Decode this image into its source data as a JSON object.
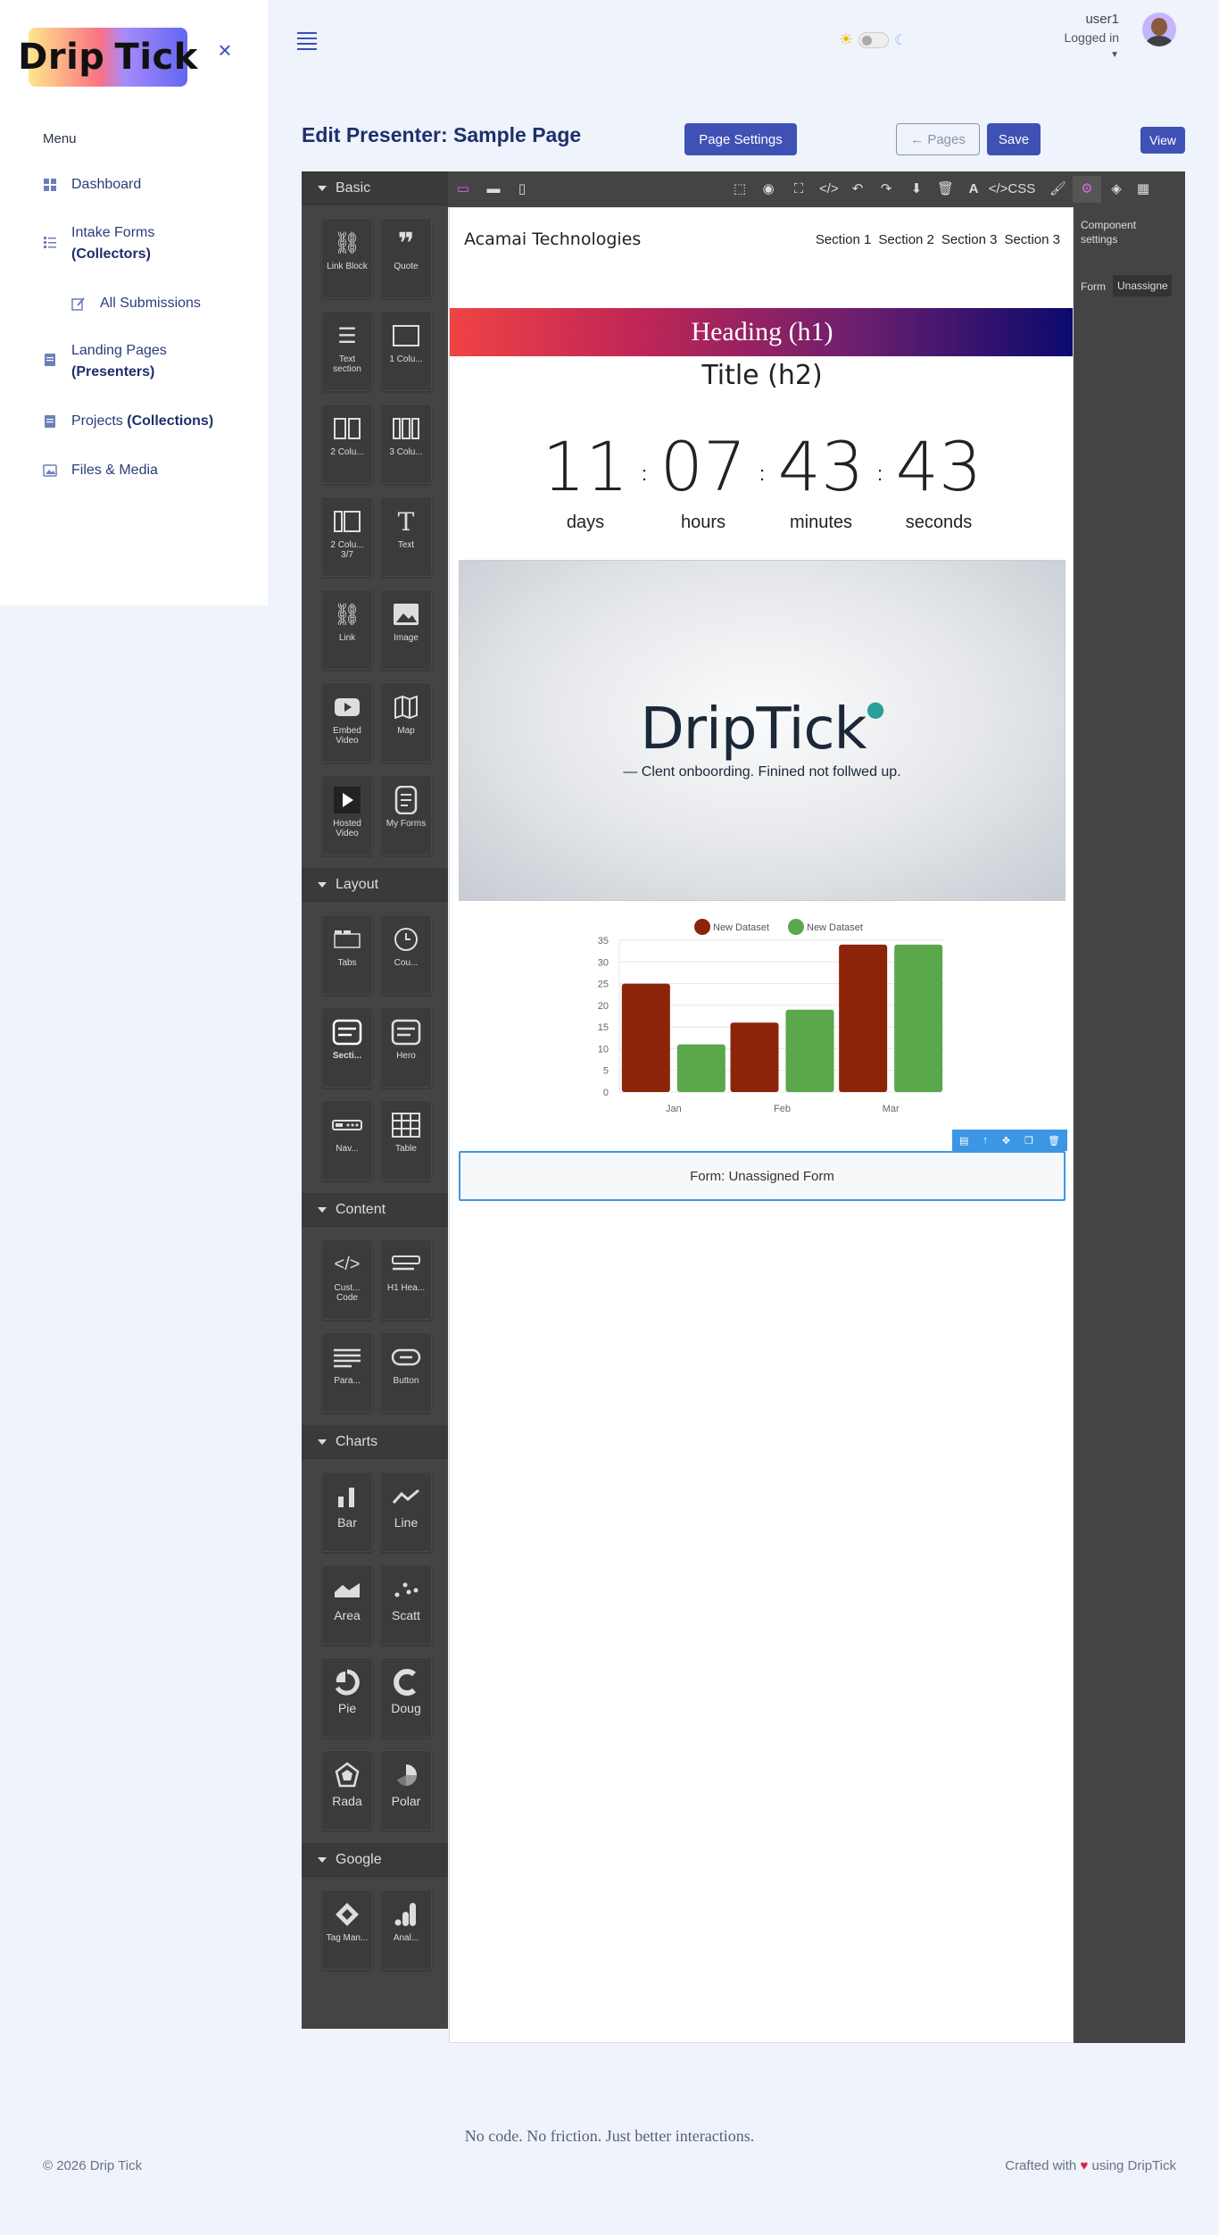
{
  "app": {
    "logo_text_left": "Drip",
    "logo_text_right": "Tick",
    "accent": "#3f51b5"
  },
  "sidebar": {
    "menu_heading": "Menu",
    "items": [
      {
        "label": "Dashboard",
        "bold": ""
      },
      {
        "label": "Intake Forms",
        "bold": "(Collectors)"
      },
      {
        "label": "All Submissions",
        "bold": ""
      },
      {
        "label": "Landing Pages",
        "bold": "(Presenters)"
      },
      {
        "label": "Projects",
        "bold": "(Collections)"
      },
      {
        "label": "Files & Media",
        "bold": ""
      }
    ]
  },
  "header": {
    "user_name": "user1",
    "user_status": "Logged in",
    "theme_light_icon": "sun-icon",
    "theme_dark_icon": "moon-icon"
  },
  "page": {
    "title": "Edit Presenter: Sample Page",
    "page_settings_label": "Page Settings",
    "pages_label": "Pages",
    "save_label": "Save",
    "view_label": "View"
  },
  "editor": {
    "categories": [
      {
        "name": "Basic",
        "blocks": [
          "Link Block",
          "Quote",
          "Text section",
          "1 Colu...",
          "2 Colu...",
          "3 Colu...",
          "2 Colu... 3/7",
          "Text",
          "Link",
          "Image",
          "Embed Video",
          "Map",
          "Hosted Video",
          "My Forms"
        ]
      },
      {
        "name": "Layout",
        "blocks": [
          "Tabs",
          "Cou...",
          "Secti...",
          "Hero",
          "Nav...",
          "Table"
        ]
      },
      {
        "name": "Content",
        "blocks": [
          "Cust... Code",
          "H1 Hea...",
          "Para...",
          "Button"
        ]
      },
      {
        "name": "Charts",
        "blocks": [
          "Bar",
          "Line",
          "Area",
          "Scatt",
          "Pie",
          "Doug",
          "Rada",
          "Polar"
        ]
      },
      {
        "name": "Google",
        "blocks": [
          "Tag Man...",
          "Anal..."
        ]
      }
    ],
    "toolbar_css_label": "CSS",
    "panel": {
      "heading": "Component settings",
      "form_label": "Form",
      "form_value": "Unassigne"
    }
  },
  "canvas": {
    "brand": "Acamai Technologies",
    "nav_links": [
      "Section 1",
      "Section 2",
      "Section 3",
      "Section 3"
    ],
    "heading_h1": "Heading (h1)",
    "title_h2": "Title (h2)",
    "countdown": [
      {
        "value": "11",
        "label": "days"
      },
      {
        "value": "07",
        "label": "hours"
      },
      {
        "value": "43",
        "label": "minutes"
      },
      {
        "value": "43",
        "label": "seconds"
      }
    ],
    "hero_logo": "DripTick",
    "hero_tagline": "— Clent onboording. Finined not follwed up.",
    "form_placeholder": "Form: Unassigned Form"
  },
  "chart_data": {
    "type": "bar",
    "categories": [
      "Jan",
      "Feb",
      "Mar"
    ],
    "series": [
      {
        "name": "New Dataset",
        "values": [
          25,
          16,
          34
        ],
        "color": "#8b2409"
      },
      {
        "name": "New Dataset",
        "values": [
          11,
          19,
          34
        ],
        "color": "#5aa74c"
      }
    ],
    "ylim": [
      0,
      35
    ],
    "yticks": [
      0,
      5,
      10,
      15,
      20,
      25,
      30,
      35
    ],
    "legend": "top",
    "grid": true
  },
  "footer": {
    "tagline": "No code. No friction. Just better interactions.",
    "copyright": "© 2026 Drip Tick",
    "crafted_prefix": "Crafted with",
    "crafted_suffix": "using DripTick"
  }
}
